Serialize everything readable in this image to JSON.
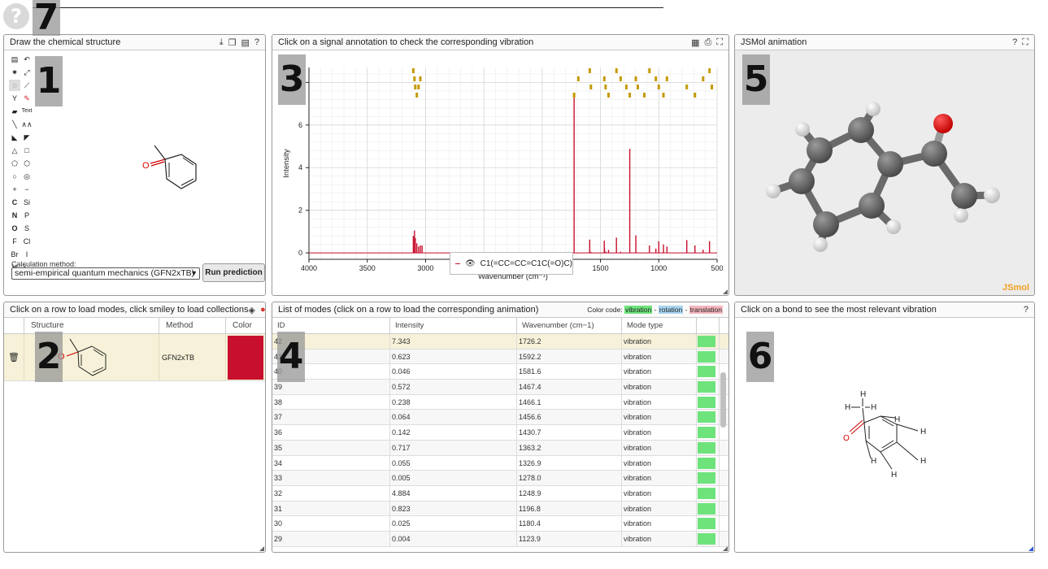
{
  "help_icon": "?",
  "badges": [
    "1",
    "2",
    "3",
    "4",
    "5",
    "6",
    "7"
  ],
  "panel1": {
    "title": "Draw the chemical structure",
    "icons": [
      "download-icon",
      "copy-icon",
      "paste-icon",
      "help-icon"
    ],
    "help_glyph": "?",
    "tools_text": [
      "Text",
      "C",
      "Si",
      "N",
      "P",
      "O",
      "S",
      "F",
      "Cl",
      "Br",
      "I",
      "H",
      "?..."
    ],
    "calc_label": "Calculation method:",
    "calc_value": "semi-empirical quantum mechanics (GFN2xTB)",
    "run_button": "Run prediction",
    "molecule_atom": "O"
  },
  "panel2": {
    "title": "Click on a row to load modes, click smiley to load collections",
    "columns": [
      "Structure",
      "Method",
      "Color"
    ],
    "row": {
      "method": "GFN2xTB",
      "color": "#c8102e",
      "atom": "O"
    }
  },
  "panel3": {
    "title": "Click on a signal annotation to check the corresponding vibration",
    "legend_label": "C1(=CC=CC=C1C(=O)C)"
  },
  "chart_data": {
    "type": "bar",
    "title": "",
    "xlabel": "Wavenumber (cm⁻¹)",
    "ylabel": "Intensity",
    "xlim": [
      4000,
      500
    ],
    "ylim": [
      -0.3,
      8.7
    ],
    "x_ticks": [
      4000,
      3500,
      3000,
      2500,
      2000,
      1500,
      1000,
      500
    ],
    "y_ticks": [
      0,
      2,
      4,
      6,
      8
    ],
    "grid": true,
    "legend_position": "bottom-center",
    "series": [
      {
        "name": "C1(=CC=CC=C1C(=O)C)",
        "color": "#c8102e",
        "x": [
          3105,
          3095,
          3088,
          3075,
          3060,
          3045,
          3030,
          1726.2,
          1592.2,
          1581.6,
          1467.4,
          1466.1,
          1456.6,
          1430.7,
          1363.2,
          1326.9,
          1278.0,
          1248.9,
          1196.8,
          1180.4,
          1123.9,
          1080,
          1025,
          1000,
          960,
          930,
          760,
          690,
          620,
          565
        ],
        "y": [
          0.8,
          1.05,
          0.7,
          0.45,
          0.3,
          0.35,
          0.35,
          7.343,
          0.623,
          0.046,
          0.572,
          0.238,
          0.064,
          0.142,
          0.717,
          0.055,
          0.005,
          4.884,
          0.823,
          0.025,
          0.004,
          0.35,
          0.2,
          0.55,
          0.4,
          0.3,
          0.6,
          0.35,
          0.15,
          0.55
        ]
      }
    ]
  },
  "panel4": {
    "title": "List of modes (click on a row to load the corresponding animation)",
    "color_code_label": "Color code:",
    "cc_vibration": "vibration",
    "cc_rotation": "rotation",
    "cc_translation": "translation",
    "cc_sep": "-",
    "columns": [
      "ID",
      "Intensity",
      "Wavenumber (cm−1)",
      "Mode type"
    ],
    "rows": [
      {
        "id": "42",
        "intensity": "7.343",
        "wavenumber": "1726.2",
        "type": "vibration"
      },
      {
        "id": "41",
        "intensity": "0.623",
        "wavenumber": "1592.2",
        "type": "vibration"
      },
      {
        "id": "40",
        "intensity": "0.046",
        "wavenumber": "1581.6",
        "type": "vibration"
      },
      {
        "id": "39",
        "intensity": "0.572",
        "wavenumber": "1467.4",
        "type": "vibration"
      },
      {
        "id": "38",
        "intensity": "0.238",
        "wavenumber": "1466.1",
        "type": "vibration"
      },
      {
        "id": "37",
        "intensity": "0.064",
        "wavenumber": "1456.6",
        "type": "vibration"
      },
      {
        "id": "36",
        "intensity": "0.142",
        "wavenumber": "1430.7",
        "type": "vibration"
      },
      {
        "id": "35",
        "intensity": "0.717",
        "wavenumber": "1363.2",
        "type": "vibration"
      },
      {
        "id": "34",
        "intensity": "0.055",
        "wavenumber": "1326.9",
        "type": "vibration"
      },
      {
        "id": "33",
        "intensity": "0.005",
        "wavenumber": "1278.0",
        "type": "vibration"
      },
      {
        "id": "32",
        "intensity": "4.884",
        "wavenumber": "1248.9",
        "type": "vibration"
      },
      {
        "id": "31",
        "intensity": "0.823",
        "wavenumber": "1196.8",
        "type": "vibration"
      },
      {
        "id": "30",
        "intensity": "0.025",
        "wavenumber": "1180.4",
        "type": "vibration"
      },
      {
        "id": "29",
        "intensity": "0.004",
        "wavenumber": "1123.9",
        "type": "vibration"
      }
    ]
  },
  "panel5": {
    "title": "JSMol animation",
    "help_glyph": "?",
    "logo": "JSmol"
  },
  "panel6": {
    "title": "Click on a bond to see the most relevant vibration",
    "help_glyph": "?",
    "atom_o": "O",
    "atom_h": "H"
  }
}
